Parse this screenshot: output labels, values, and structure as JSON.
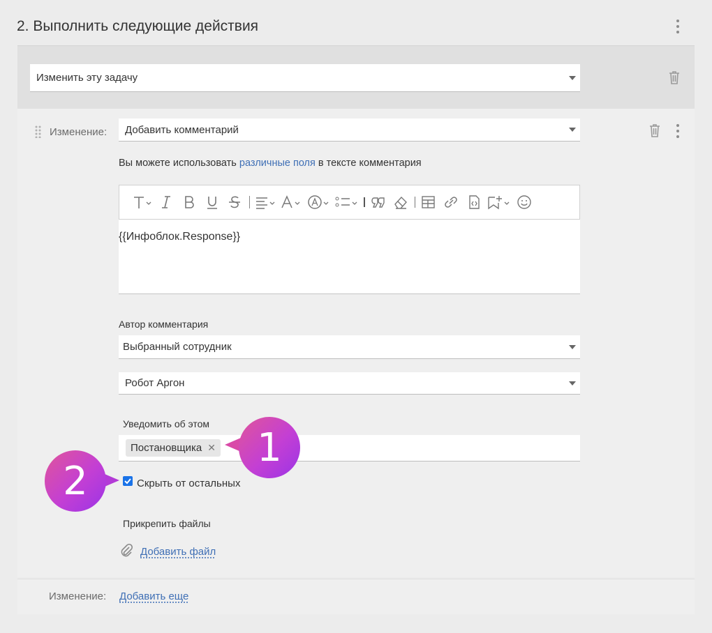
{
  "header": {
    "title": "2. Выполнить следующие действия"
  },
  "action_select": {
    "value": "Изменить эту задачу"
  },
  "change": {
    "label": "Изменение:",
    "type_value": "Добавить комментарий",
    "hint_prefix": "Вы можете использовать ",
    "hint_link": "различные поля",
    "hint_suffix": " в тексте комментария",
    "comment_text": "{{Инфоблок.Response}}",
    "author_label": "Автор комментария",
    "author_value": "Выбранный сотрудник",
    "employee_value": "Робот Аргон",
    "notify_label": "Уведомить об этом",
    "notify_tag": "Постановщика",
    "hide_label": "Скрыть от остальных",
    "hide_checked": true,
    "attach_label": "Прикрепить файлы",
    "attach_link": "Добавить файл"
  },
  "footer": {
    "label": "Изменение:",
    "add_more": "Добавить еще"
  },
  "callouts": {
    "one": "1",
    "two": "2"
  },
  "toolbar_icons": [
    "font-size-icon",
    "italic-icon",
    "bold-icon",
    "underline-icon",
    "strikethrough-icon",
    "align-icon",
    "font-color-icon",
    "text-style-icon",
    "list-icon",
    "quote-icon",
    "eraser-icon",
    "table-icon",
    "link-icon",
    "code-icon",
    "insert-icon",
    "emoji-icon"
  ],
  "colors": {
    "accent": "#3f6fb5",
    "badge_start": "#e0559a",
    "badge_end": "#9b34e6",
    "checkbox": "#1a73e8"
  }
}
